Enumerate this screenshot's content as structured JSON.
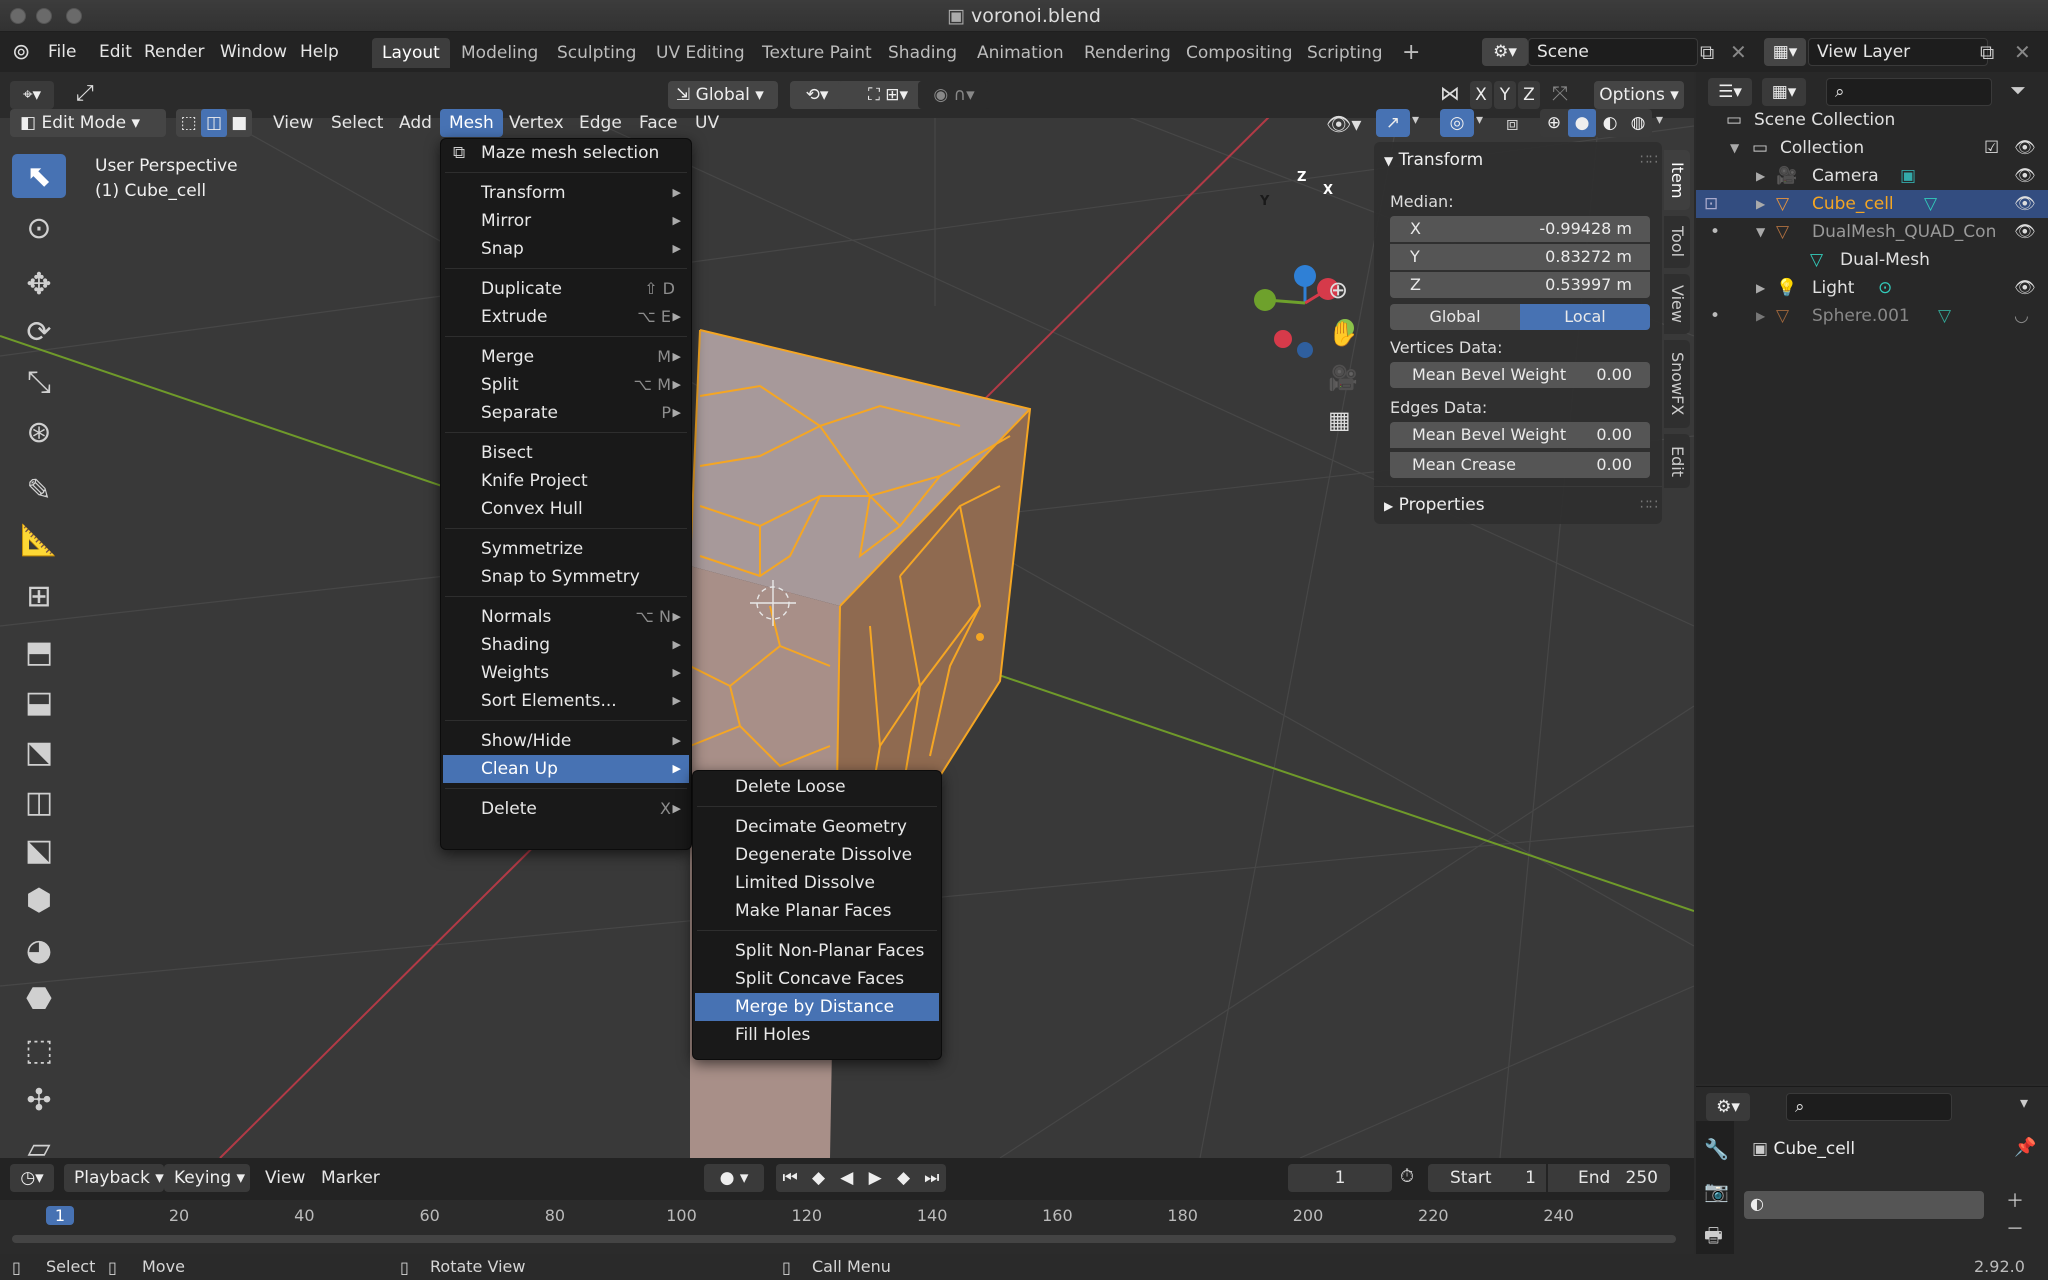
{
  "window": {
    "title": "voronoi.blend",
    "version": "2.92.0"
  },
  "topmenu": [
    "File",
    "Edit",
    "Render",
    "Window",
    "Help"
  ],
  "workspaces": [
    "Layout",
    "Modeling",
    "Sculpting",
    "UV Editing",
    "Texture Paint",
    "Shading",
    "Animation",
    "Rendering",
    "Compositing",
    "Scripting"
  ],
  "scene": {
    "name": "Scene",
    "view_layer": "View Layer"
  },
  "viewport_header": {
    "transform_orientation": "Global",
    "options": "Options",
    "axes": [
      "X",
      "Y",
      "Z"
    ],
    "mode": "Edit Mode",
    "menus": [
      "View",
      "Select",
      "Add",
      "Mesh",
      "Vertex",
      "Edge",
      "Face",
      "UV"
    ]
  },
  "viewport_info": {
    "perspective": "User Perspective",
    "object": "(1) Cube_cell"
  },
  "gizmo": {
    "x": "X",
    "y": "Y",
    "z": "Z"
  },
  "mesh_menu": {
    "items": [
      {
        "label": "Maze mesh selection",
        "shortcut": "",
        "submenu": false
      },
      {
        "label": "Transform",
        "shortcut": "",
        "submenu": true
      },
      {
        "label": "Mirror",
        "shortcut": "",
        "submenu": true
      },
      {
        "label": "Snap",
        "shortcut": "",
        "submenu": true
      },
      {
        "label": "Duplicate",
        "shortcut": "⇧ D",
        "submenu": false
      },
      {
        "label": "Extrude",
        "shortcut": "⌥ E",
        "submenu": true
      },
      {
        "label": "Merge",
        "shortcut": "M",
        "submenu": true
      },
      {
        "label": "Split",
        "shortcut": "⌥ M",
        "submenu": true
      },
      {
        "label": "Separate",
        "shortcut": "P",
        "submenu": true
      },
      {
        "label": "Bisect",
        "shortcut": "",
        "submenu": false
      },
      {
        "label": "Knife Project",
        "shortcut": "",
        "submenu": false
      },
      {
        "label": "Convex Hull",
        "shortcut": "",
        "submenu": false
      },
      {
        "label": "Symmetrize",
        "shortcut": "",
        "submenu": false
      },
      {
        "label": "Snap to Symmetry",
        "shortcut": "",
        "submenu": false
      },
      {
        "label": "Normals",
        "shortcut": "⌥ N",
        "submenu": true
      },
      {
        "label": "Shading",
        "shortcut": "",
        "submenu": true
      },
      {
        "label": "Weights",
        "shortcut": "",
        "submenu": true
      },
      {
        "label": "Sort Elements...",
        "shortcut": "",
        "submenu": true
      },
      {
        "label": "Show/Hide",
        "shortcut": "",
        "submenu": true
      },
      {
        "label": "Clean Up",
        "shortcut": "",
        "submenu": true
      },
      {
        "label": "Delete",
        "shortcut": "X",
        "submenu": true
      }
    ],
    "highlighted": "Clean Up"
  },
  "cleanup_menu": {
    "items": [
      "Delete Loose",
      "Decimate Geometry",
      "Degenerate Dissolve",
      "Limited Dissolve",
      "Make Planar Faces",
      "Split Non-Planar Faces",
      "Split Concave Faces",
      "Merge by Distance",
      "Fill Holes"
    ],
    "highlighted": "Merge by Distance"
  },
  "transform_panel": {
    "title": "Transform",
    "median_label": "Median:",
    "x": {
      "label": "X",
      "value": "-0.99428 m"
    },
    "y": {
      "label": "Y",
      "value": "0.83272 m"
    },
    "z": {
      "label": "Z",
      "value": "0.53997 m"
    },
    "space_global": "Global",
    "space_local": "Local",
    "vertices_label": "Vertices Data:",
    "vertex_bevel": {
      "label": "Mean Bevel Weight",
      "value": "0.00"
    },
    "edges_label": "Edges Data:",
    "edge_bevel": {
      "label": "Mean Bevel Weight",
      "value": "0.00"
    },
    "edge_crease": {
      "label": "Mean Crease",
      "value": "0.00"
    },
    "properties": "Properties"
  },
  "sidebar_tabs": [
    "Item",
    "Tool",
    "View",
    "SnowFX",
    "Edit"
  ],
  "outliner": {
    "root": "Scene Collection",
    "collection": "Collection",
    "items": [
      "Camera",
      "Cube_cell",
      "DualMesh_QUAD_Con",
      "Dual-Mesh",
      "Light",
      "Sphere.001"
    ]
  },
  "properties": {
    "object": "Cube_cell"
  },
  "timeline": {
    "menus": [
      "Playback",
      "Keying",
      "View",
      "Marker"
    ],
    "current_frame": "1",
    "start_label": "Start",
    "start": "1",
    "end_label": "End",
    "end": "250",
    "ticks": [
      "1",
      "20",
      "40",
      "60",
      "80",
      "100",
      "120",
      "140",
      "160",
      "180",
      "200",
      "220",
      "240"
    ]
  },
  "statusbar": {
    "select": "Select",
    "move": "Move",
    "rotate": "Rotate View",
    "call_menu": "Call Menu"
  },
  "colors": {
    "accent": "#4772b3",
    "selection": "#f5a623",
    "background": "#393939"
  }
}
